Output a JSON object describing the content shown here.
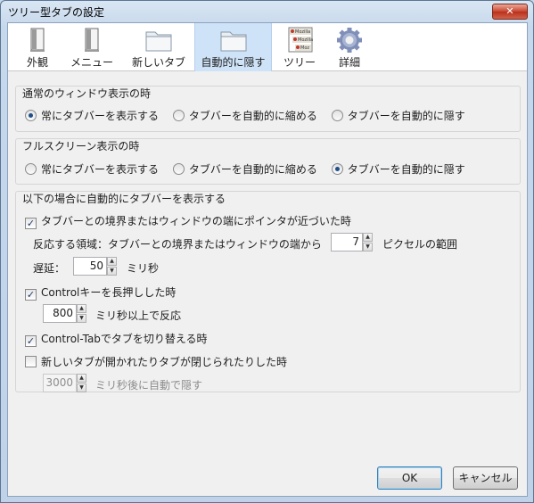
{
  "window": {
    "title": "ツリー型タブの設定",
    "close_symbol": "✕"
  },
  "toolbar": {
    "items": [
      {
        "label": "外観",
        "icon": "window-icon"
      },
      {
        "label": "メニュー",
        "icon": "window-icon"
      },
      {
        "label": "新しいタブ",
        "icon": "folder-icon"
      },
      {
        "label": "自動的に隠す",
        "icon": "folder-icon",
        "selected": true
      },
      {
        "label": "ツリー",
        "icon": "tree-tabs-icon"
      },
      {
        "label": "詳細",
        "icon": "gear-icon"
      }
    ],
    "tree_icon_text": [
      "Mozilla",
      "Mozilla",
      "Moz"
    ]
  },
  "normal_mode": {
    "title": "通常のウィンドウ表示の時",
    "options": [
      "常にタブバーを表示する",
      "タブバーを自動的に縮める",
      "タブバーを自動的に隠す"
    ],
    "selected_index": 0
  },
  "fullscreen_mode": {
    "title": "フルスクリーン表示の時",
    "options": [
      "常にタブバーを表示する",
      "タブバーを自動的に縮める",
      "タブバーを自動的に隠す"
    ],
    "selected_index": 2
  },
  "auto_show": {
    "title": "以下の場合に自動的にタブバーを表示する",
    "pointer": {
      "label": "タブバーとの境界またはウィンドウの端にポインタが近づいた時",
      "checked": true,
      "area_label": "反応する領域：タブバーとの境界またはウィンドウの端から",
      "area_value": "7",
      "area_unit": "ピクセルの範囲",
      "delay_label": "遅延：",
      "delay_value": "50",
      "delay_unit": "ミリ秒"
    },
    "control_key": {
      "label": "Controlキーを長押しした時",
      "checked": true,
      "value": "800",
      "unit": "ミリ秒以上で反応"
    },
    "control_tab": {
      "label": "Control-Tabでタブを切り替える時",
      "checked": true
    },
    "tab_open_close": {
      "label": "新しいタブが開かれたりタブが閉じられたりした時",
      "checked": false,
      "value": "3000",
      "unit": "ミリ秒後に自動で隠す"
    }
  },
  "buttons": {
    "ok": "OK",
    "cancel": "キャンセル"
  },
  "check_mark": "✓",
  "spin_up": "▲",
  "spin_down": "▼",
  "colors": {
    "selected_tab": "#cfe3f8",
    "close_button": "#c9452f",
    "window_frame": "#c6d8ec"
  }
}
